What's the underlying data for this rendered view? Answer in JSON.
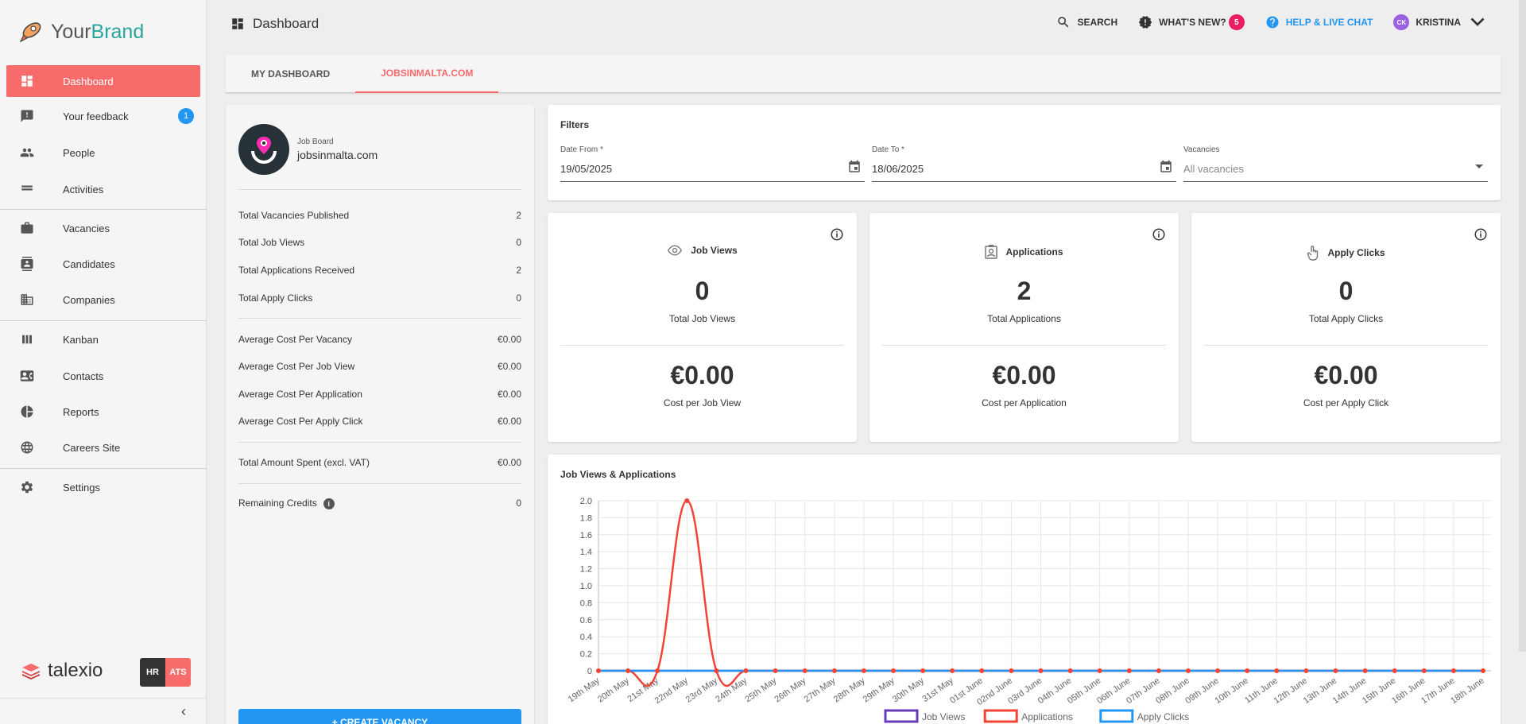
{
  "brand": {
    "part1": "Your",
    "part2": "Brand"
  },
  "sidebar": {
    "items": [
      {
        "label": "Dashboard"
      },
      {
        "label": "Your feedback",
        "badge": "1"
      },
      {
        "label": "People"
      },
      {
        "label": "Activities"
      },
      {
        "label": "Vacancies"
      },
      {
        "label": "Candidates"
      },
      {
        "label": "Companies"
      },
      {
        "label": "Kanban"
      },
      {
        "label": "Contacts"
      },
      {
        "label": "Reports"
      },
      {
        "label": "Careers Site"
      },
      {
        "label": "Settings"
      }
    ],
    "footer_brand": "talexio",
    "hr_label": "HR",
    "ats_label": "ATS",
    "collapse": "‹"
  },
  "header": {
    "title": "Dashboard",
    "search": "SEARCH",
    "whats_new": "WHAT'S NEW?",
    "whats_new_count": "5",
    "help": "HELP & LIVE CHAT",
    "user_initials": "CK",
    "user_name": "KRISTINA"
  },
  "tabs": [
    {
      "label": "MY DASHBOARD"
    },
    {
      "label": "JOBSINMALTA.COM"
    }
  ],
  "job_board": {
    "small_label": "Job Board",
    "name": "jobsinmalta.com",
    "stats": [
      {
        "label": "Total Vacancies Published",
        "value": "2"
      },
      {
        "label": "Total Job Views",
        "value": "0"
      },
      {
        "label": "Total Applications Received",
        "value": "2"
      },
      {
        "label": "Total Apply Clicks",
        "value": "0"
      }
    ],
    "costs": [
      {
        "label": "Average Cost Per Vacancy",
        "value": "€0.00"
      },
      {
        "label": "Average Cost Per Job View",
        "value": "€0.00"
      },
      {
        "label": "Average Cost Per Application",
        "value": "€0.00"
      },
      {
        "label": "Average Cost Per Apply Click",
        "value": "€0.00"
      }
    ],
    "total_spent": {
      "label": "Total Amount Spent (excl. VAT)",
      "value": "€0.00"
    },
    "credits": {
      "label": "Remaining Credits",
      "value": "0"
    },
    "create_button": "+ CREATE VACANCY"
  },
  "filters": {
    "title": "Filters",
    "date_from": {
      "label": "Date From *",
      "value": "19/05/2025"
    },
    "date_to": {
      "label": "Date To *",
      "value": "18/06/2025"
    },
    "vacancies": {
      "label": "Vacancies",
      "placeholder": "All vacancies"
    }
  },
  "metrics": [
    {
      "title": "Job Views",
      "value": "0",
      "caption": "Total Job Views",
      "cost": "€0.00",
      "cost_caption": "Cost per Job View",
      "icon": "eye-icon"
    },
    {
      "title": "Applications",
      "value": "2",
      "caption": "Total Applications",
      "cost": "€0.00",
      "cost_caption": "Cost per Application",
      "icon": "applications-icon"
    },
    {
      "title": "Apply Clicks",
      "value": "0",
      "caption": "Total Apply Clicks",
      "cost": "€0.00",
      "cost_caption": "Cost per Apply Click",
      "icon": "pointer-icon"
    }
  ],
  "chart_data": {
    "type": "line",
    "title": "Job Views & Applications",
    "x": [
      "19th May",
      "20th May",
      "21st May",
      "22nd May",
      "23rd May",
      "24th May",
      "25th May",
      "26th May",
      "27th May",
      "28th May",
      "29th May",
      "30th May",
      "31st May",
      "01st June",
      "02nd June",
      "03rd June",
      "04th June",
      "05th June",
      "06th June",
      "07th June",
      "08th June",
      "09th June",
      "10th June",
      "11th June",
      "12th June",
      "13th June",
      "14th June",
      "15th June",
      "16th June",
      "17th June",
      "18th June"
    ],
    "ylim": [
      0,
      2
    ],
    "yticks": [
      "2.0",
      "1.8",
      "1.6",
      "1.4",
      "1.2",
      "1.0",
      "0.8",
      "0.6",
      "0.4",
      "0.2",
      "0"
    ],
    "grid": true,
    "legend_position": "bottom",
    "series": [
      {
        "name": "Job Views",
        "color": "#673ab7",
        "values": [
          0,
          0,
          0,
          0,
          0,
          0,
          0,
          0,
          0,
          0,
          0,
          0,
          0,
          0,
          0,
          0,
          0,
          0,
          0,
          0,
          0,
          0,
          0,
          0,
          0,
          0,
          0,
          0,
          0,
          0,
          0
        ]
      },
      {
        "name": "Applications",
        "color": "#f44336",
        "values": [
          0,
          0,
          0,
          2,
          0,
          0,
          0,
          0,
          0,
          0,
          0,
          0,
          0,
          0,
          0,
          0,
          0,
          0,
          0,
          0,
          0,
          0,
          0,
          0,
          0,
          0,
          0,
          0,
          0,
          0,
          0
        ]
      },
      {
        "name": "Apply Clicks",
        "color": "#2196f3",
        "values": [
          0,
          0,
          0,
          0,
          0,
          0,
          0,
          0,
          0,
          0,
          0,
          0,
          0,
          0,
          0,
          0,
          0,
          0,
          0,
          0,
          0,
          0,
          0,
          0,
          0,
          0,
          0,
          0,
          0,
          0,
          0
        ]
      }
    ]
  }
}
